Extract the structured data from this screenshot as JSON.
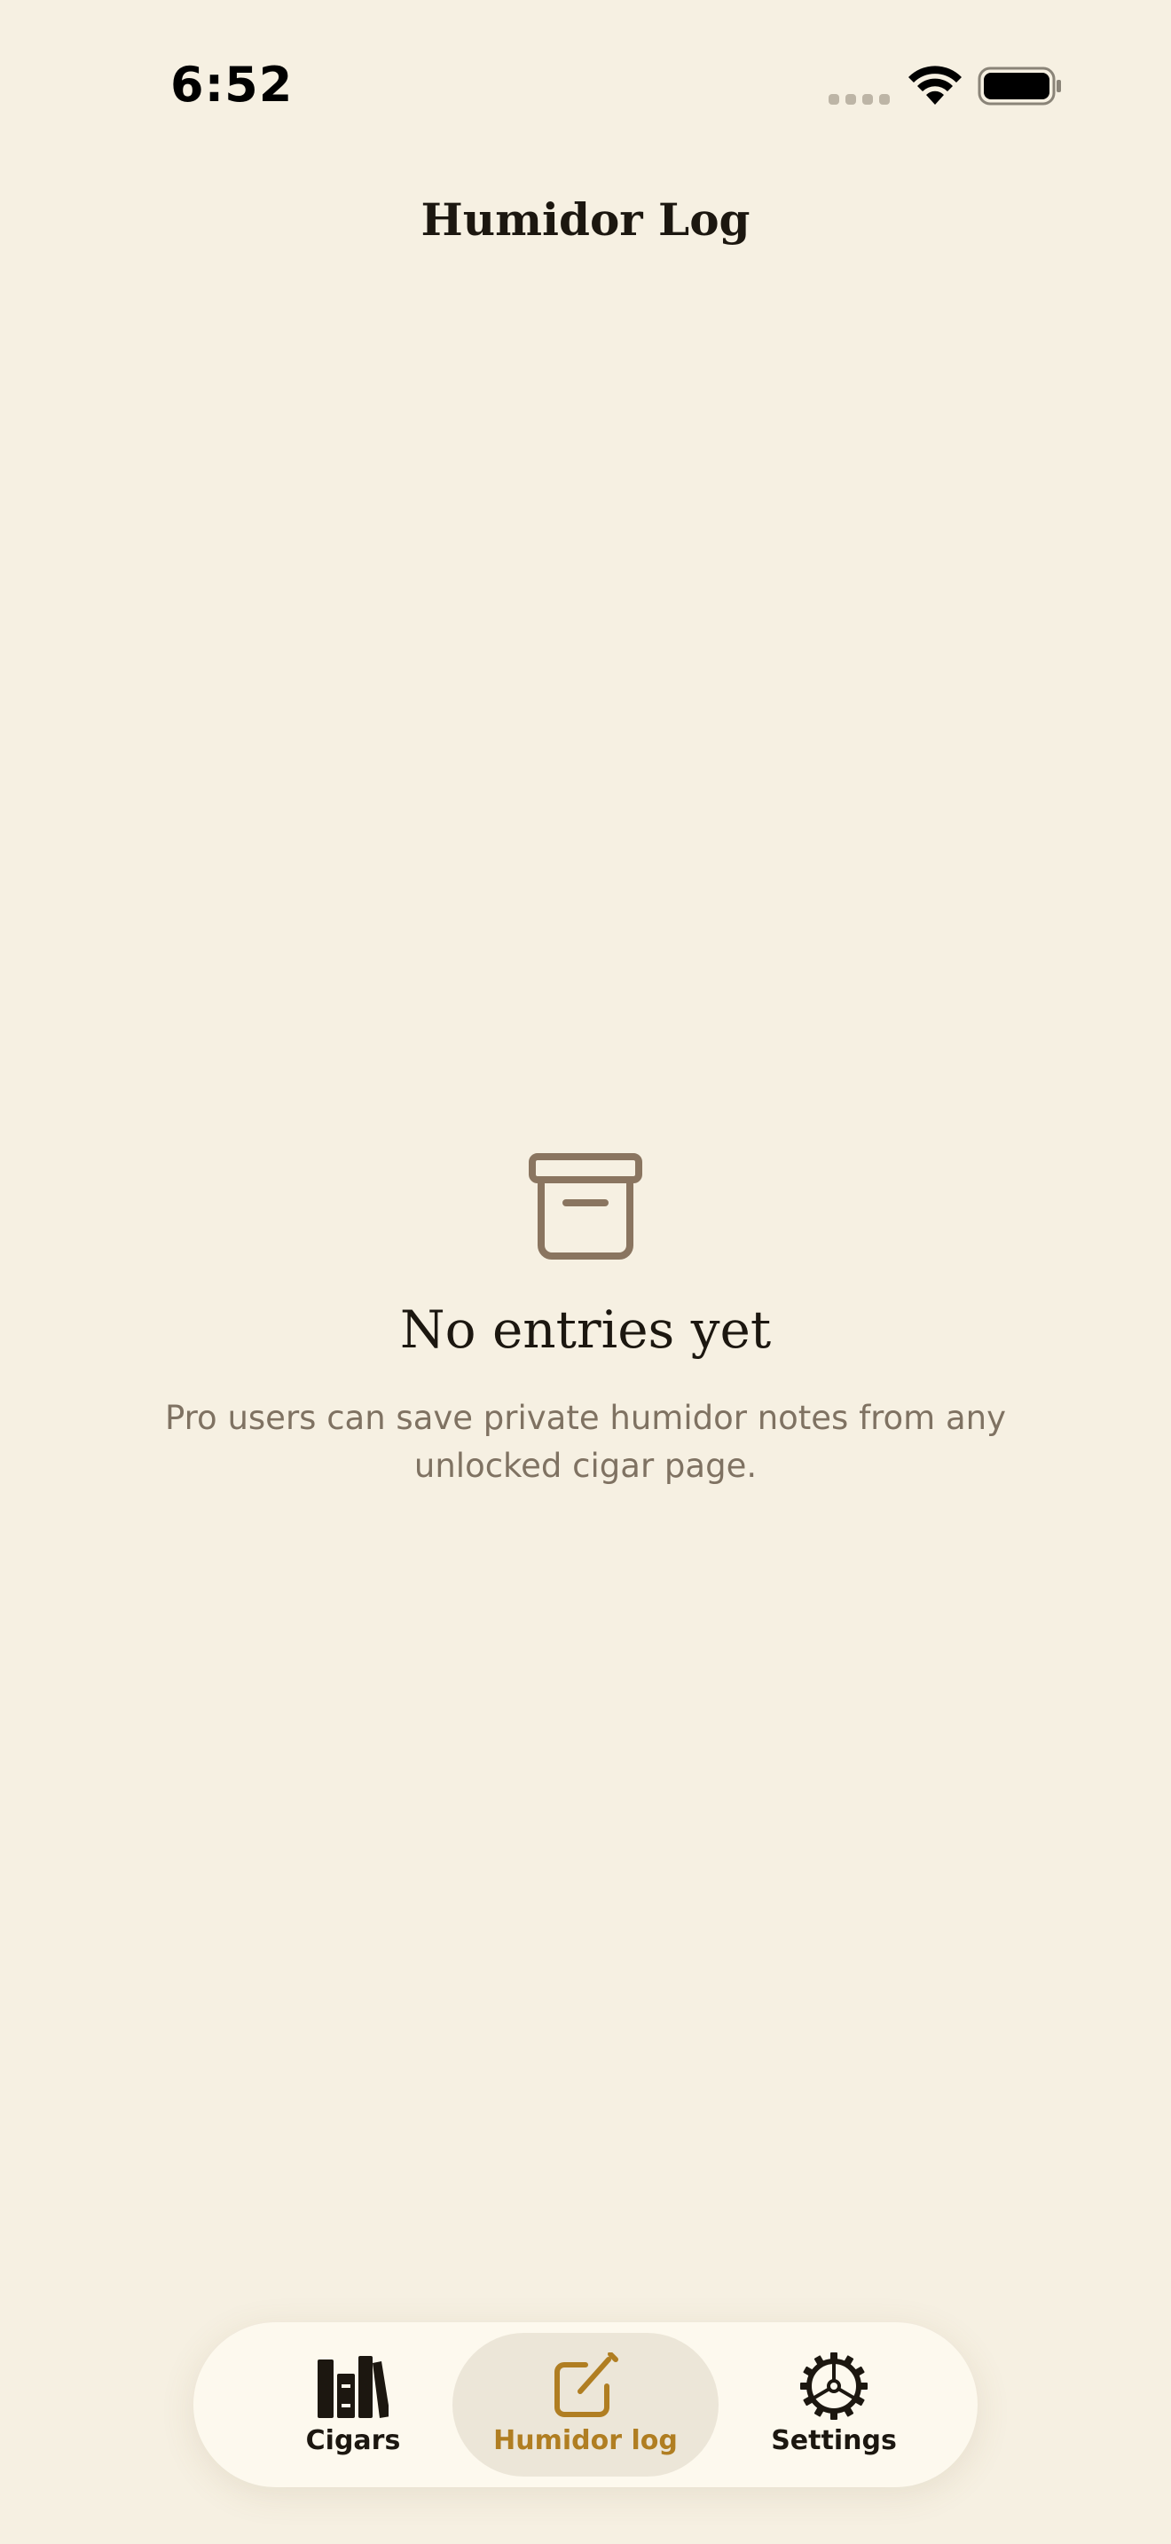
{
  "status_bar": {
    "time": "6:52",
    "icons": [
      "signal-icon",
      "wifi-icon",
      "battery-icon"
    ]
  },
  "header": {
    "title": "Humidor Log"
  },
  "empty_state": {
    "icon": "archive-box-icon",
    "title": "No entries yet",
    "description": "Pro users can save private humidor notes from any unlocked cigar page."
  },
  "tab_bar": {
    "selected": "Humidor log",
    "tabs": [
      {
        "label": "Cigars",
        "icon": "books-icon"
      },
      {
        "label": "Humidor log",
        "icon": "edit-note-icon"
      },
      {
        "label": "Settings",
        "icon": "gear-icon"
      }
    ]
  },
  "colors": {
    "background": "#f6f0e2",
    "accent": "#b07e22",
    "text_primary": "#1c1710",
    "text_secondary": "#7f7262",
    "tab_bar_bg": "#fdf9ee",
    "tab_selected_bg": "#ece6d8"
  }
}
